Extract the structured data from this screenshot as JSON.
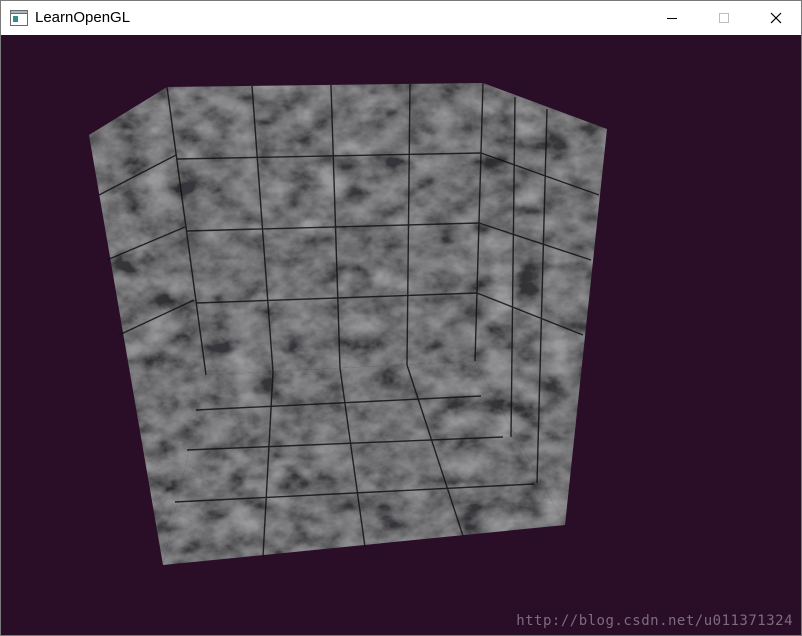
{
  "window": {
    "title": "LearnOpenGL",
    "controls": {
      "minimize_icon": "minimize-icon",
      "maximize_icon": "maximize-icon",
      "close_icon": "close-icon"
    }
  },
  "scene": {
    "background_color": "#2a0e28",
    "description_icon": "marble-room-3d-render"
  },
  "watermark": {
    "text": "http://blog.csdn.net/u011371324"
  }
}
